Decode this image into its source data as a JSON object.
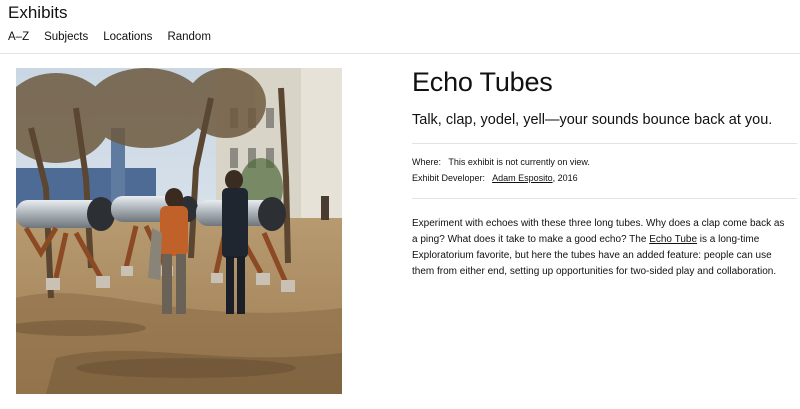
{
  "header": {
    "site_title": "Exhibits",
    "nav": [
      "A–Z",
      "Subjects",
      "Locations",
      "Random"
    ]
  },
  "photo": {
    "alt": "Visitors using the Echo Tubes exhibit outdoors"
  },
  "exhibit": {
    "title": "Echo Tubes",
    "subtitle": "Talk, clap, yodel, yell—your sounds bounce back at you.",
    "where_label": "Where:",
    "where_value": "This exhibit is not currently on view.",
    "developer_label": "Exhibit Developer:",
    "developer_name": "Adam Esposito",
    "developer_year": ", 2016",
    "desc_part1": "Experiment with echoes with these three long tubes. Why does a clap come back as a ping? What does it take to make a good echo? The ",
    "desc_link": "Echo Tube",
    "desc_part2": " is a long-time Exploratorium favorite, but here the tubes have an added feature: people can use them from either end, setting up opportunities for two-sided play and collaboration."
  }
}
